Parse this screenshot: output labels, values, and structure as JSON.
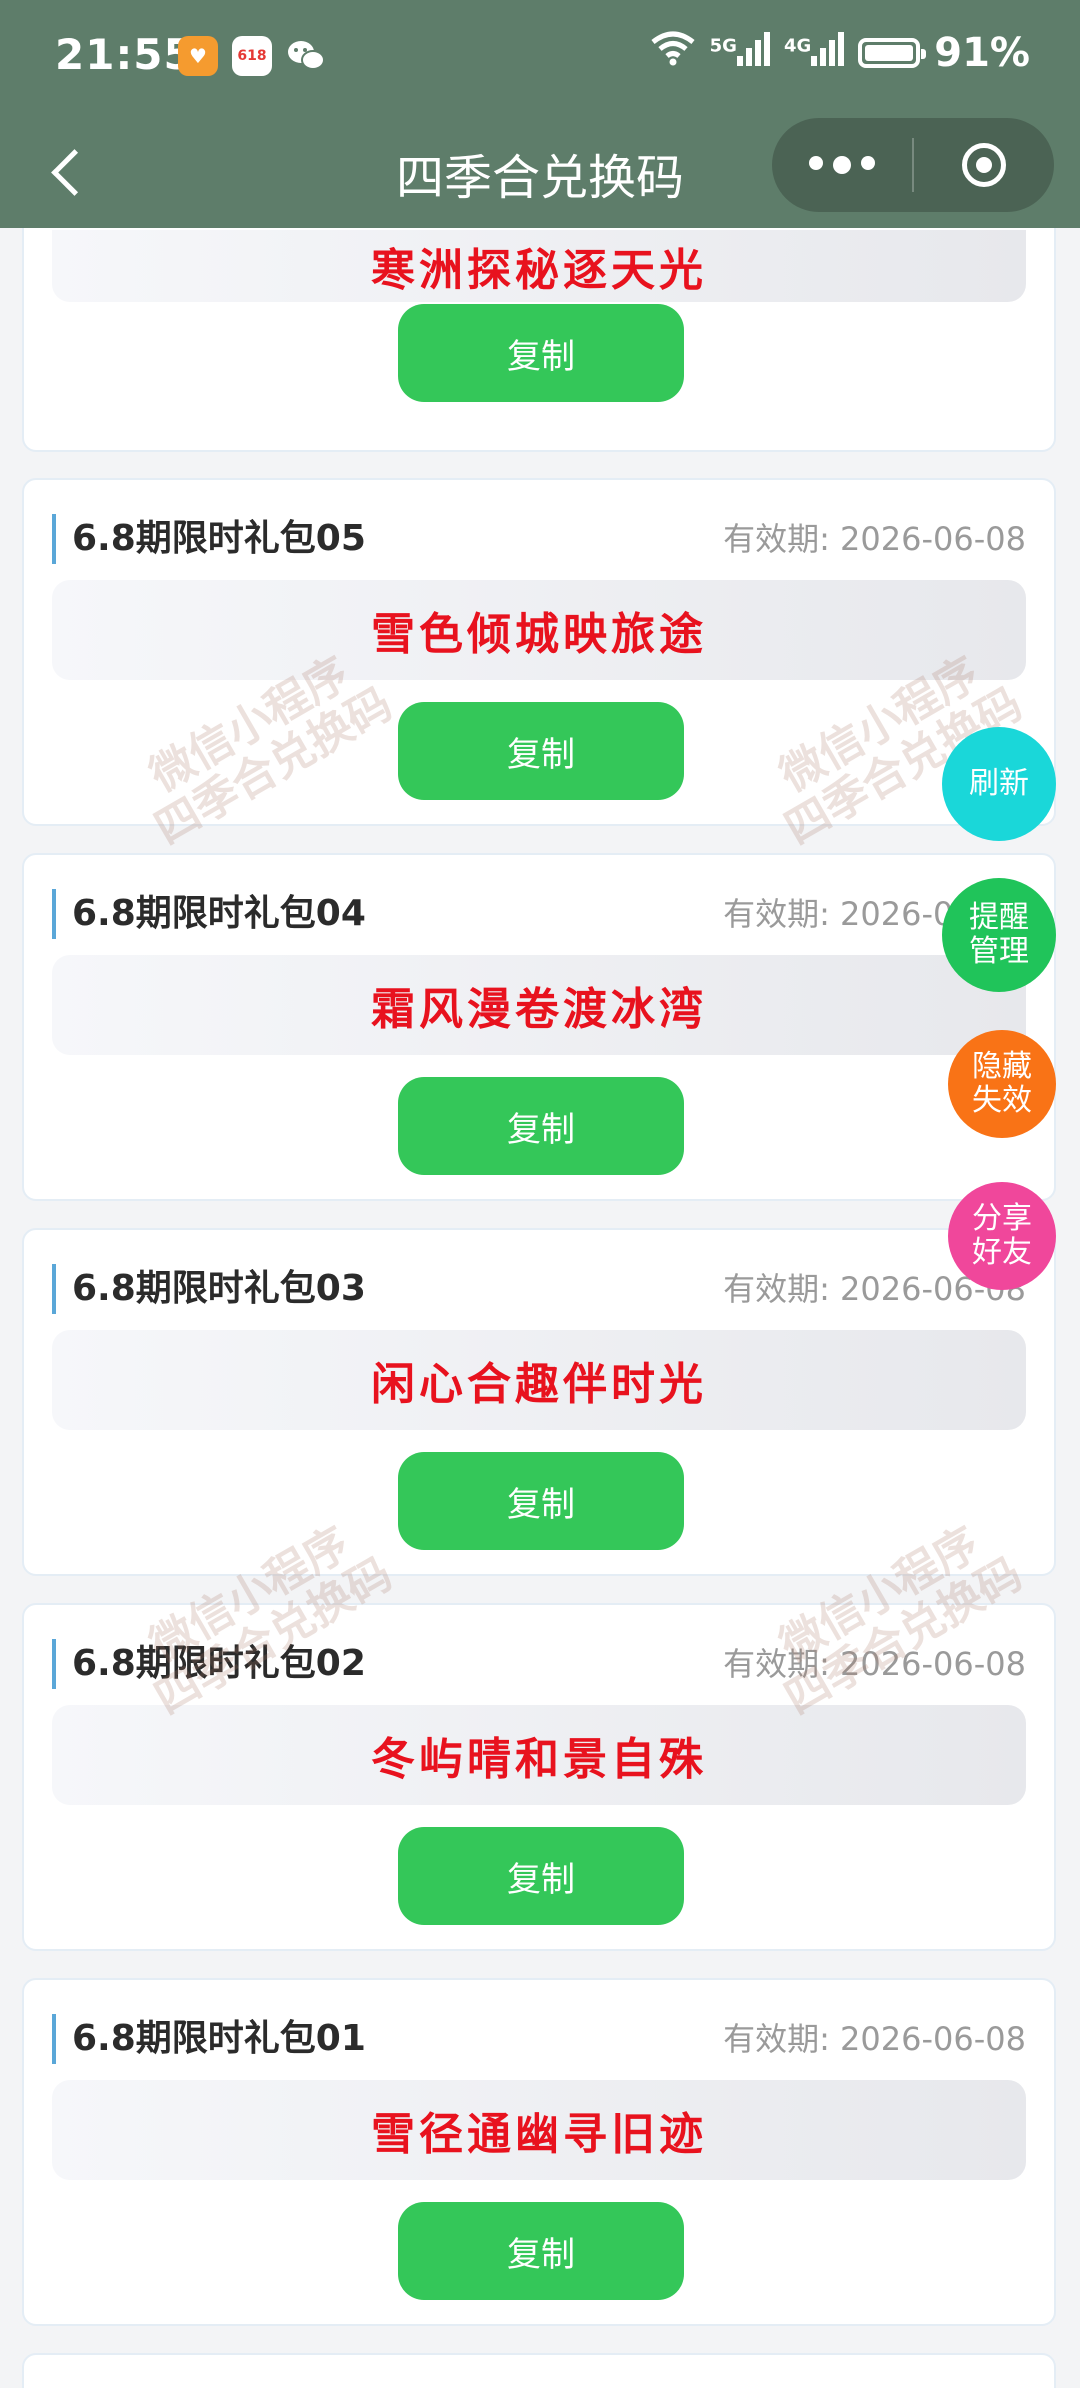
{
  "status_bar": {
    "time": "21:55",
    "network_wifi": "6",
    "network_5g": "5G",
    "network_4g": "4G",
    "battery": "91%"
  },
  "nav": {
    "title": "四季合兑换码"
  },
  "watermark": {
    "line1": "微信小程序",
    "line2": "四季合兑换码"
  },
  "first_card": {
    "code": "寒洲探秘逐天光",
    "copy_label": "复制"
  },
  "cards": [
    {
      "title": "6.8期限时礼包05",
      "expiry": "有效期: 2026-06-08",
      "code": "雪色倾城映旅途",
      "copy_label": "复制"
    },
    {
      "title": "6.8期限时礼包04",
      "expiry": "有效期: 2026-06-08",
      "code": "霜风漫卷渡冰湾",
      "copy_label": "复制"
    },
    {
      "title": "6.8期限时礼包03",
      "expiry": "有效期: 2026-06-08",
      "code": "闲心合趣伴时光",
      "copy_label": "复制"
    },
    {
      "title": "6.8期限时礼包02",
      "expiry": "有效期: 2026-06-08",
      "code": "冬屿晴和景自殊",
      "copy_label": "复制"
    },
    {
      "title": "6.8期限时礼包01",
      "expiry": "有效期: 2026-06-08",
      "code": "雪径通幽寻旧迹",
      "copy_label": "复制"
    }
  ],
  "floating_buttons": {
    "refresh": "刷新",
    "remind": [
      "提醒",
      "管理"
    ],
    "hide": [
      "隐藏",
      "失效"
    ],
    "share": [
      "分享",
      "好友"
    ]
  },
  "colors": {
    "header_bg": "#5e7d6a",
    "code_text": "#e8121e",
    "copy_button": "#34c759",
    "refresh_fab": "#1ad7d9",
    "remind_fab": "#20c45a",
    "hide_fab": "#f97316",
    "share_fab": "#f0479b"
  }
}
